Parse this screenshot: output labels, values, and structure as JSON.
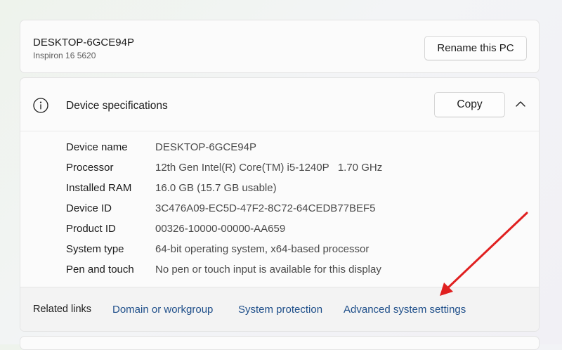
{
  "pc": {
    "name": "DESKTOP-6GCE94P",
    "model": "Inspiron 16 5620",
    "rename_label": "Rename this PC"
  },
  "specs": {
    "title": "Device specifications",
    "copy_label": "Copy",
    "rows": [
      {
        "label": "Device name",
        "value": "DESKTOP-6GCE94P"
      },
      {
        "label": "Processor",
        "value": "12th Gen Intel(R) Core(TM) i5-1240P   1.70 GHz"
      },
      {
        "label": "Installed RAM",
        "value": "16.0 GB (15.7 GB usable)"
      },
      {
        "label": "Device ID",
        "value": "3C476A09-EC5D-47F2-8C72-64CEDB77BEF5"
      },
      {
        "label": "Product ID",
        "value": "00326-10000-00000-AA659"
      },
      {
        "label": "System type",
        "value": "64-bit operating system, x64-based processor"
      },
      {
        "label": "Pen and touch",
        "value": "No pen or touch input is available for this display"
      }
    ]
  },
  "related": {
    "label": "Related links",
    "links": [
      "Domain or workgroup",
      "System protection",
      "Advanced system settings"
    ]
  },
  "colors": {
    "link": "#1f4f8a",
    "annotation_arrow": "#e02020"
  },
  "icons": {
    "info": "info-icon",
    "collapse": "chevron-up-icon"
  }
}
